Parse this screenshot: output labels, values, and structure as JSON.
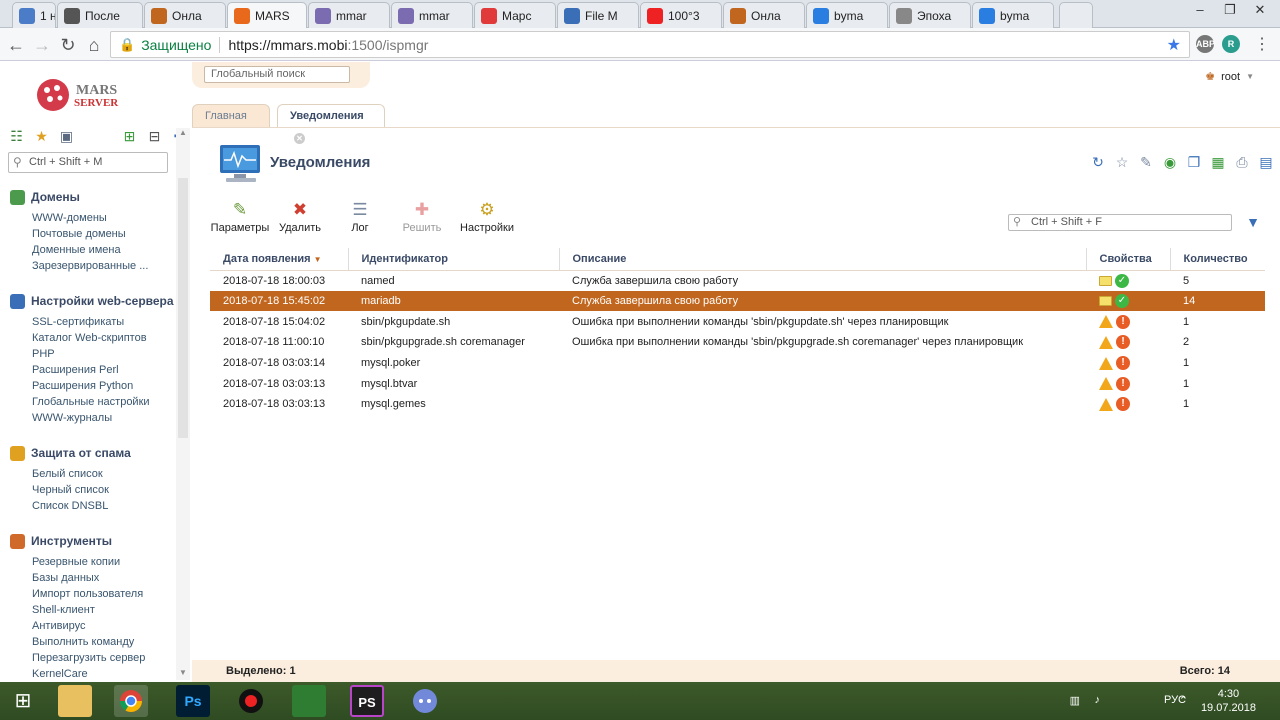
{
  "browser": {
    "tabs": [
      {
        "label": "1 н",
        "icon": "page-icon",
        "color": "#4a7cc8"
      },
      {
        "label": "После",
        "icon": "page-icon",
        "color": "#555555"
      },
      {
        "label": "Онла",
        "icon": "dollar-icon",
        "color": "#c0661e"
      },
      {
        "label": "MARS",
        "icon": "mars-icon",
        "color": "#e8691c"
      },
      {
        "label": "mmar",
        "icon": "pma-icon",
        "color": "#7b6bb0"
      },
      {
        "label": "mmar",
        "icon": "pma-icon",
        "color": "#7b6bb0"
      },
      {
        "label": "Марс",
        "icon": "mars-icon",
        "color": "#e03a3a"
      },
      {
        "label": "File M",
        "icon": "file-icon",
        "color": "#3a6fb7"
      },
      {
        "label": "100°3",
        "icon": "yandex-icon",
        "color": "#e22"
      },
      {
        "label": "Онла",
        "icon": "dollar-icon",
        "color": "#c0661e"
      },
      {
        "label": "byma",
        "icon": "b-icon",
        "color": "#2a7de1"
      },
      {
        "label": "Эпоха",
        "icon": "x-icon",
        "color": "#888"
      },
      {
        "label": "byma",
        "icon": "b-icon",
        "color": "#2a7de1"
      }
    ],
    "secure_label": "Защищено",
    "url_host": "https://mmars.mobi",
    "url_path": ":1500/ispmgr"
  },
  "header": {
    "global_search_placeholder": "Глобальный поиск",
    "user": "root"
  },
  "sidebar": {
    "search_placeholder": "Ctrl + Shift + M",
    "sections": [
      {
        "title": "Домены",
        "items": [
          "WWW-домены",
          "Почтовые домены",
          "Доменные имена",
          "Зарезервированные ..."
        ]
      },
      {
        "title": "Настройки web-сервера",
        "items": [
          "SSL-сертификаты",
          "Каталог Web-скриптов",
          "PHP",
          "Расширения Perl",
          "Расширения Python",
          "Глобальные настройки",
          "WWW-журналы"
        ]
      },
      {
        "title": "Защита от спама",
        "items": [
          "Белый список",
          "Черный список",
          "Список DNSBL"
        ]
      },
      {
        "title": "Инструменты",
        "items": [
          "Резервные копии",
          "Базы данных",
          "Импорт пользователя",
          "Shell-клиент",
          "Антивирус",
          "Выполнить команду",
          "Перезагрузить сервер",
          "KernelCare"
        ]
      }
    ]
  },
  "page_tabs": {
    "home": "Главная",
    "notifications": "Уведомления"
  },
  "page": {
    "title": "Уведомления",
    "toolbar": {
      "params": "Параметры",
      "delete": "Удалить",
      "log": "Лог",
      "resolve": "Решить",
      "settings": "Настройки"
    },
    "filter_placeholder": "Ctrl + Shift + F",
    "columns": [
      "Дата появления",
      "Идентификатор",
      "Описание",
      "Свойства",
      "Количество"
    ],
    "rows": [
      {
        "date": "2018-07-18 18:00:03",
        "id": "named",
        "desc": "Служба завершила свою работу",
        "type": "ok",
        "count": "5"
      },
      {
        "date": "2018-07-18 15:45:02",
        "id": "mariadb",
        "desc": "Служба завершила свою работу",
        "type": "ok",
        "count": "14"
      },
      {
        "date": "2018-07-18 15:04:02",
        "id": "sbin/pkgupdate.sh",
        "desc": "Ошибка при выполнении команды 'sbin/pkgupdate.sh' через планировщик",
        "type": "err",
        "count": "1"
      },
      {
        "date": "2018-07-18 11:00:10",
        "id": "sbin/pkgupgrade.sh coremanager",
        "desc": "Ошибка при выполнении команды 'sbin/pkgupgrade.sh coremanager' через планировщик",
        "type": "err",
        "count": "2"
      },
      {
        "date": "2018-07-18 03:03:14",
        "id": "mysql.poker",
        "desc": "",
        "type": "err",
        "count": "1"
      },
      {
        "date": "2018-07-18 03:03:13",
        "id": "mysql.btvar",
        "desc": "",
        "type": "err",
        "count": "1"
      },
      {
        "date": "2018-07-18 03:03:13",
        "id": "mysql.gemes",
        "desc": "",
        "type": "err",
        "count": "1"
      }
    ],
    "selected_row": 1,
    "selected_text": "Выделено: 1",
    "total_text": "Всего: 14"
  },
  "taskbar": {
    "lang": "РУС",
    "time": "4:30",
    "date": "19.07.2018"
  }
}
